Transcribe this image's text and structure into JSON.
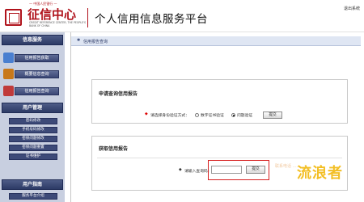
{
  "header": {
    "org_top": "— 中国人民银行 —",
    "logo_text": "征信中心",
    "logo_en": "CREDIT REFERENCE CENTER, THE PEOPLE'S BANK OF CHINA",
    "site_title": "个人信用信息服务平台",
    "logout_label": "退出系统"
  },
  "sidebar": {
    "sections": [
      {
        "label": "信息服务"
      },
      {
        "label": "用户管理"
      },
      {
        "label": "用户指南"
      }
    ],
    "service_items": [
      {
        "label": "信用报告获取",
        "icon": "report-icon",
        "icon_color": "#4a7fd0"
      },
      {
        "label": "概要信息查询",
        "icon": "summary-icon",
        "icon_color": "#c8781a"
      },
      {
        "label": "信用报告查询",
        "icon": "query-icon",
        "icon_color": "#c03a3a"
      }
    ],
    "user_links": [
      {
        "label": "密码修改"
      },
      {
        "label": "手机号码修改"
      },
      {
        "label": "密保问题修改"
      },
      {
        "label": "密保问题重置"
      },
      {
        "label": "证书维护"
      }
    ],
    "guide_links": [
      {
        "label": "服务平台介绍"
      }
    ]
  },
  "main": {
    "breadcrumb": "信用报告查询",
    "apply_panel": {
      "title": "申请查询信用报告",
      "prompt": "请选择身份验证方式：",
      "options": [
        {
          "label": "数字证书验证",
          "checked": false
        },
        {
          "label": "问题验证",
          "checked": true
        }
      ],
      "submit_label": "提交"
    },
    "obtain_panel": {
      "title": "获取信用报告",
      "code_label": "请输入查询码：",
      "code_value": "",
      "submit_label": "提交"
    }
  },
  "watermark": "流浪者",
  "watermark_faint": "联系电话 ……"
}
